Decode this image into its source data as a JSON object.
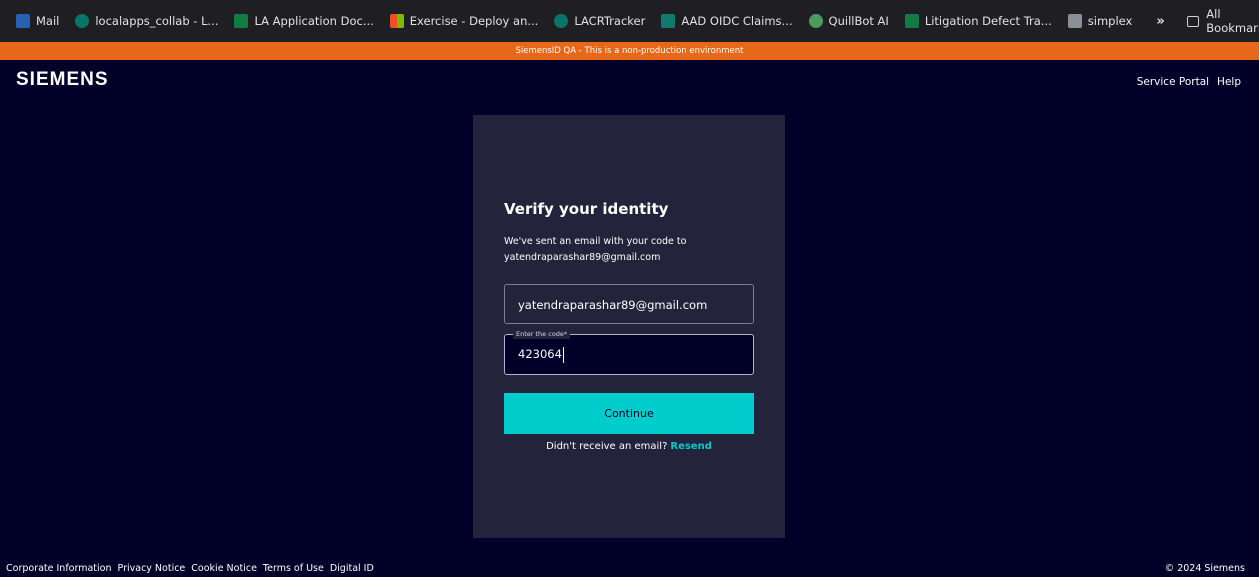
{
  "bookmarks": [
    {
      "label": "Mail",
      "icon": "mail-icon"
    },
    {
      "label": "localapps_collab - L...",
      "icon": "sharepoint-icon"
    },
    {
      "label": "LA Application Doc...",
      "icon": "excel-icon"
    },
    {
      "label": "Exercise - Deploy an...",
      "icon": "microsoft-icon"
    },
    {
      "label": "LACRTracker",
      "icon": "sharepoint-icon"
    },
    {
      "label": "AAD OIDC Claims...",
      "icon": "aad-icon"
    },
    {
      "label": "QuillBot AI",
      "icon": "quillbot-icon"
    },
    {
      "label": "Litigation Defect Tra...",
      "icon": "excel-icon"
    },
    {
      "label": "simplex",
      "icon": "simplex-icon"
    }
  ],
  "bookmarks_more": "»",
  "all_bookmarks": "All Bookmarks",
  "env_banner": "SiemensID QA - This is a non-production environment",
  "logo": "SIEMENS",
  "header_links": {
    "service_portal": "Service Portal",
    "help": "Help"
  },
  "card": {
    "title": "Verify your identity",
    "description": "We've sent an email with your code to yatendraparashar89@gmail.com",
    "email_value": "yatendraparashar89@gmail.com",
    "code_label": "Enter the code*",
    "code_value": "423064",
    "continue_label": "Continue",
    "resend_question": "Didn't receive an email?",
    "resend_link": "Resend"
  },
  "footer": {
    "links": [
      "Corporate Information",
      "Privacy Notice",
      "Cookie Notice",
      "Terms of Use",
      "Digital ID"
    ],
    "copyright": "© 2024 Siemens"
  },
  "colors": {
    "page_bg": "#000028",
    "card_bg": "#23233c",
    "accent": "#00cccc",
    "banner": "#e8681a"
  }
}
